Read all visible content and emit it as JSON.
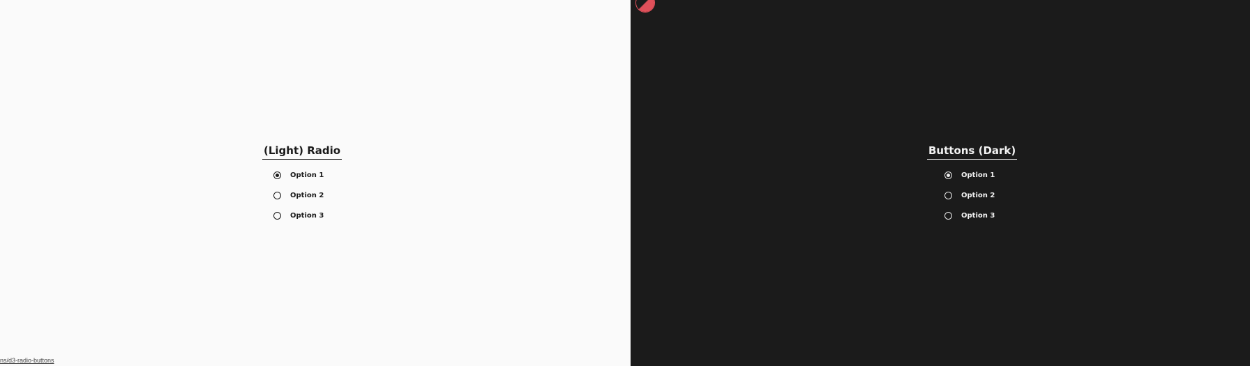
{
  "light_panel": {
    "title": "(Light) Radio",
    "options": [
      {
        "label": "Option 1",
        "selected": true
      },
      {
        "label": "Option 2",
        "selected": false
      },
      {
        "label": "Option 3",
        "selected": false
      }
    ]
  },
  "dark_panel": {
    "title": "Buttons (Dark)",
    "options": [
      {
        "label": "Option 1",
        "selected": true
      },
      {
        "label": "Option 2",
        "selected": false
      },
      {
        "label": "Option 3",
        "selected": false
      }
    ]
  },
  "theme_toggle": {
    "icon": "theme-toggle-icon",
    "accent_color": "#e0505a"
  },
  "status_bar": {
    "link_text": "ns/d3-radio-buttons"
  },
  "colors": {
    "light_background": "#fafafa",
    "dark_background": "#1b1b1b"
  }
}
